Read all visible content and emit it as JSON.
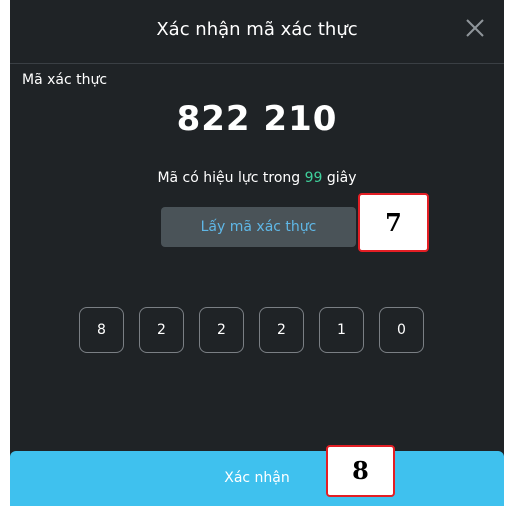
{
  "dialog": {
    "title": "Xác nhận mã xác thực",
    "close_icon": "close-icon"
  },
  "code": {
    "label": "Mã xác thực",
    "value": "822 210",
    "validity_prefix": "Mã có hiệu lực trong ",
    "validity_seconds": "99",
    "validity_suffix": " giây",
    "seconds_color": "#3fd19c"
  },
  "get_code_button": {
    "label": "Lấy mã xác thực"
  },
  "otp_digits": [
    "8",
    "2",
    "2",
    "2",
    "1",
    "0"
  ],
  "confirm_button": {
    "label": "Xác nhận"
  },
  "badges": {
    "step_7": "7",
    "step_8": "8"
  },
  "colors": {
    "background": "#1f2326",
    "accent": "#3fc1ee",
    "button_text": "#5fb7e6",
    "badge_border": "#e31e24"
  }
}
